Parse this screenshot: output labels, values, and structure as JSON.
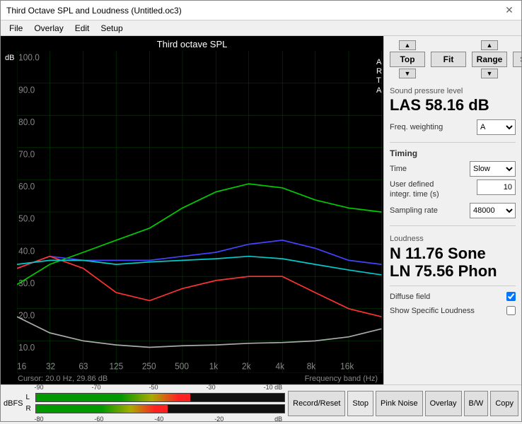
{
  "window": {
    "title": "Third Octave SPL and Loudness (Untitled.oc3)",
    "close_label": "✕"
  },
  "menu": {
    "items": [
      "File",
      "Overlay",
      "Edit",
      "Setup"
    ]
  },
  "chart": {
    "title": "Third octave SPL",
    "y_label": "dB",
    "y_max": "100.0",
    "x_ticks": [
      "16",
      "32",
      "63",
      "125",
      "250",
      "500",
      "1k",
      "2k",
      "4k",
      "8k",
      "16k"
    ],
    "y_ticks": [
      "100.0",
      "90.0",
      "80.0",
      "70.0",
      "60.0",
      "50.0",
      "40.0",
      "30.0",
      "20.0",
      "10.0"
    ],
    "cursor_label": "Cursor:",
    "cursor_value": "20.0 Hz, 29.86 dB",
    "freq_label": "Frequency band (Hz)",
    "arta": "A\nR\nT\nA"
  },
  "controls": {
    "top_label": "Top",
    "fit_label": "Fit",
    "range_label": "Range",
    "set_label": "Set"
  },
  "spl": {
    "section_label": "Sound pressure level",
    "value": "LAS 58.16 dB",
    "freq_weighting_label": "Freq. weighting",
    "freq_weighting_value": "A"
  },
  "timing": {
    "section_label": "Timing",
    "time_label": "Time",
    "time_value": "Slow",
    "user_defined_label": "User defined\nintegr. time (s)",
    "user_defined_value": "10",
    "sampling_label": "Sampling rate",
    "sampling_value": "48000"
  },
  "loudness": {
    "section_label": "Loudness",
    "n_value": "N 11.76 Sone",
    "ln_value": "LN 75.56 Phon",
    "diffuse_field_label": "Diffuse field",
    "diffuse_field_checked": true,
    "show_specific_label": "Show Specific Loudness",
    "show_specific_checked": false
  },
  "bottom": {
    "dbfs_label": "dBFS",
    "l_label": "L",
    "r_label": "R",
    "scale_l": [
      "-90",
      "-70",
      "-50",
      "-30",
      "-10 dB"
    ],
    "scale_r": [
      "-80",
      "-60",
      "-40",
      "-20",
      "dB"
    ],
    "buttons": [
      "Record/Reset",
      "Stop",
      "Pink Noise",
      "Overlay",
      "B/W",
      "Copy"
    ]
  }
}
